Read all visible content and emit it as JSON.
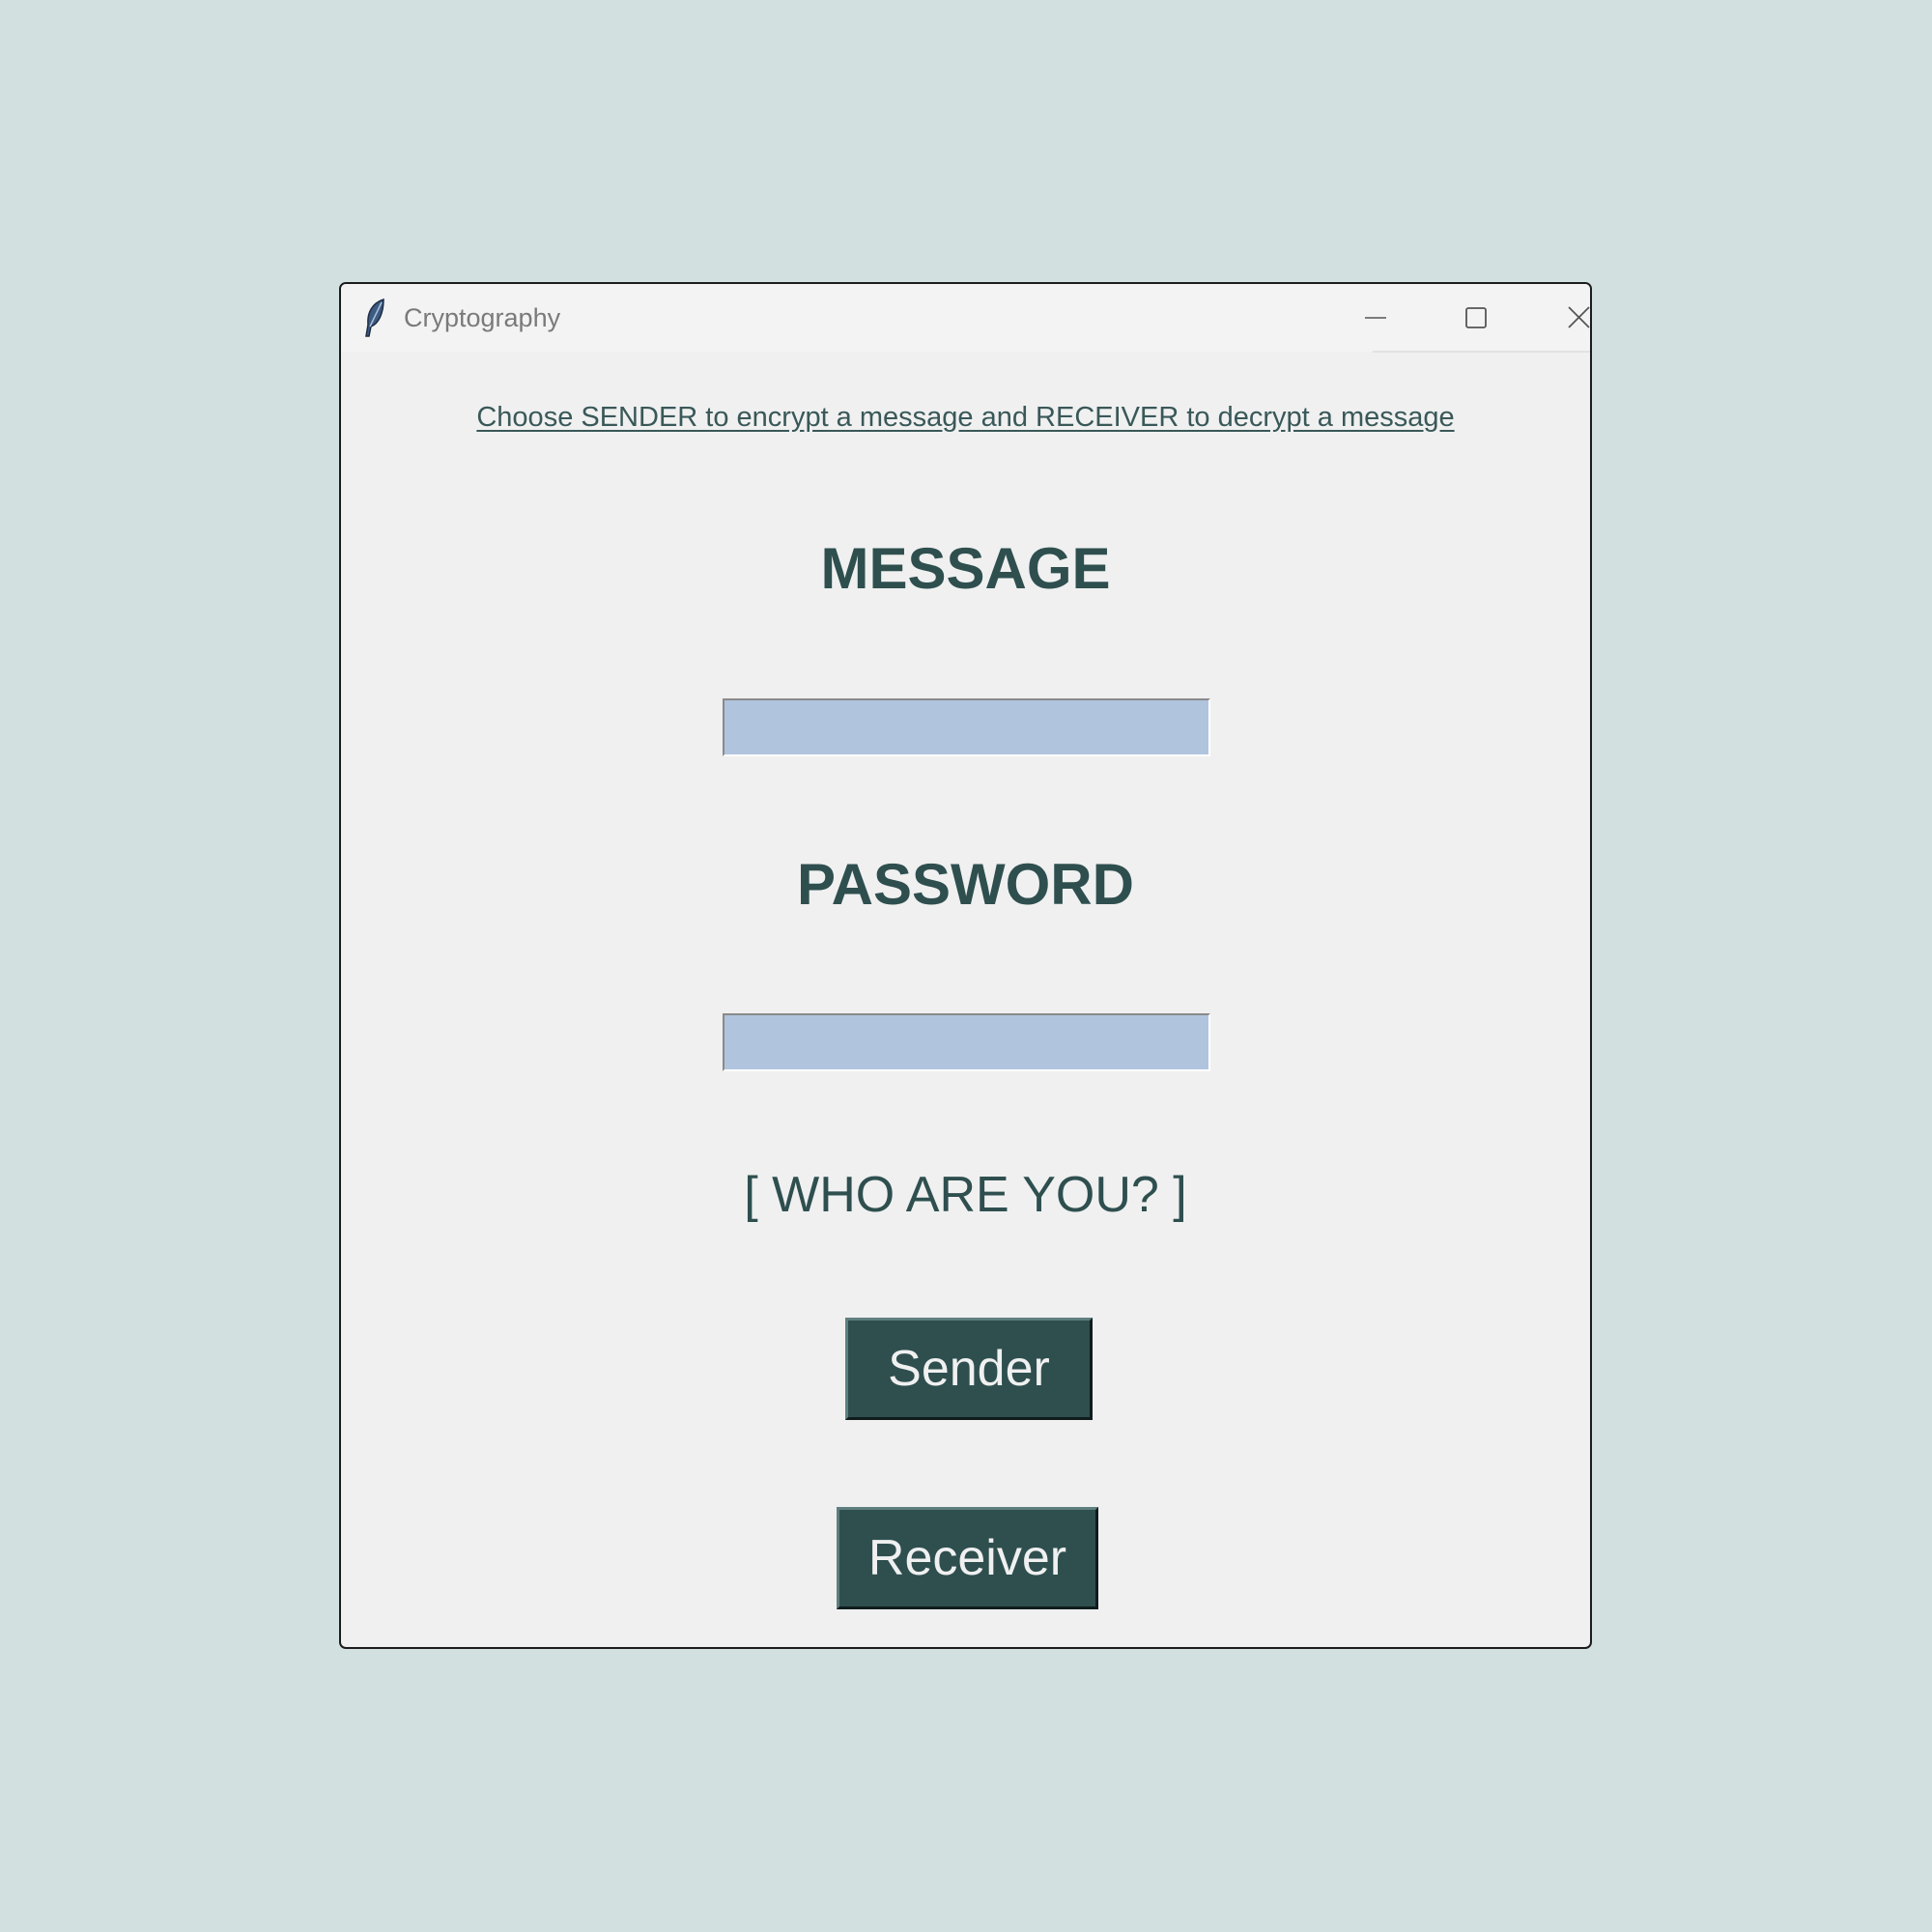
{
  "window": {
    "title": "Cryptography",
    "icon": "feather-icon"
  },
  "controls": {
    "minimize_icon": "minimize-icon",
    "maximize_icon": "maximize-icon",
    "close_icon": "close-icon"
  },
  "main": {
    "instruction": "Choose SENDER to encrypt a message and RECEIVER to decrypt a message",
    "message_label": "MESSAGE",
    "message_value": "",
    "password_label": "PASSWORD",
    "password_value": "",
    "who_prompt": "[ WHO ARE YOU? ]",
    "sender_button": "Sender",
    "receiver_button": "Receiver"
  },
  "colors": {
    "desktop_background": "#d3e0e0",
    "window_background": "#f0f0f0",
    "text_primary": "#2f4f4f",
    "field_background": "#b0c4de",
    "button_background": "#2f4f4f",
    "button_text": "#f0f0f0"
  }
}
